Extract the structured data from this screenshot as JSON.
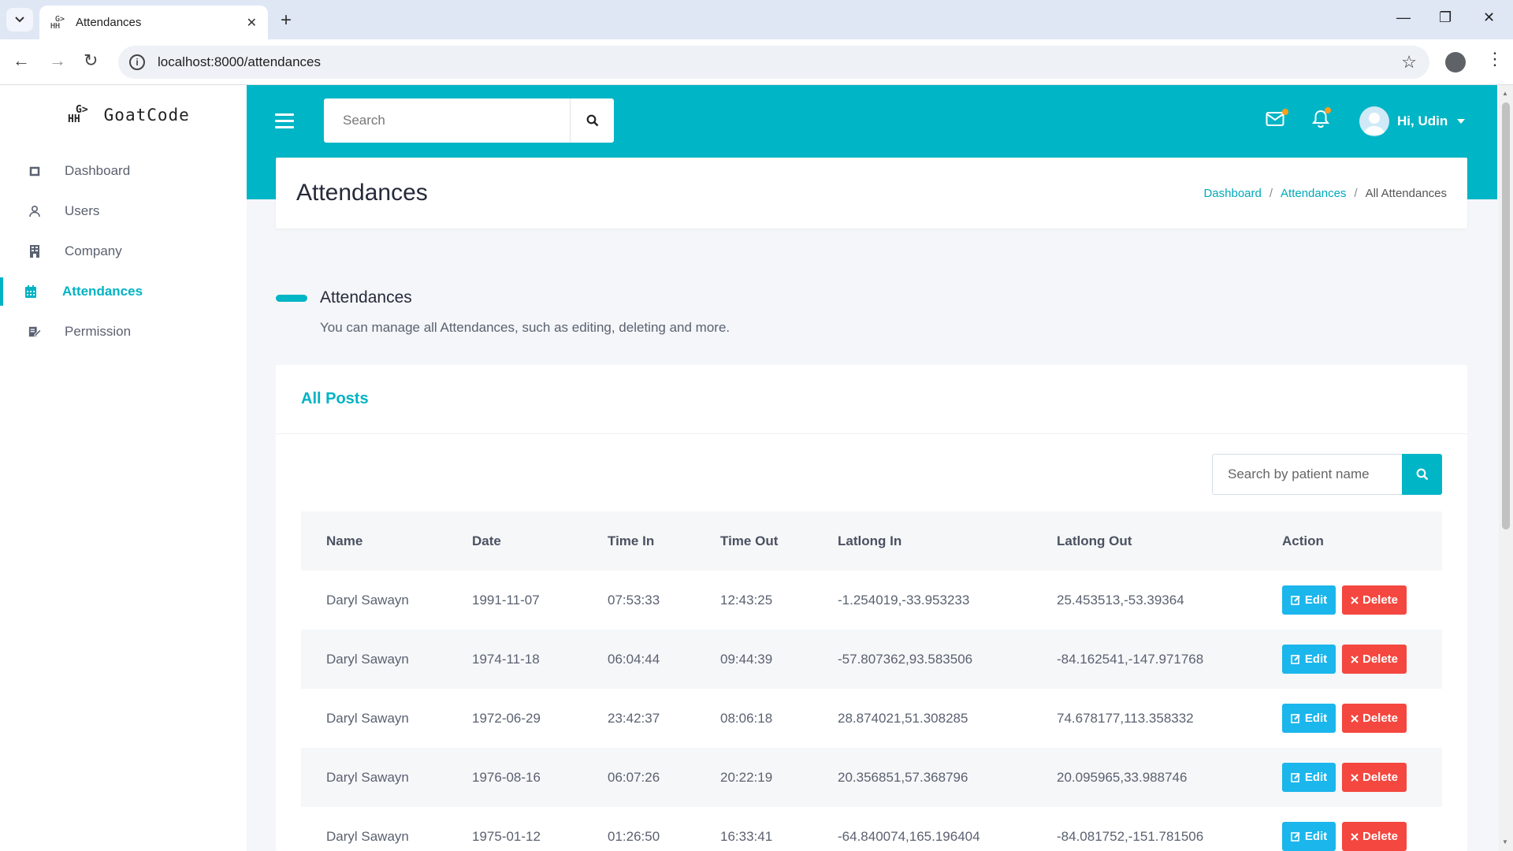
{
  "browser": {
    "tab_title": "Attendances",
    "url": "localhost:8000/attendances"
  },
  "app": {
    "brand": "GoatCode",
    "brand_logo_top": "G>",
    "brand_logo_bottom": "HH",
    "accent_color": "#00b5c5"
  },
  "sidebar": {
    "items": [
      {
        "label": "Dashboard",
        "icon": "dashboard-icon"
      },
      {
        "label": "Users",
        "icon": "user-icon"
      },
      {
        "label": "Company",
        "icon": "building-icon"
      },
      {
        "label": "Attendances",
        "icon": "calendar-icon",
        "active": true
      },
      {
        "label": "Permission",
        "icon": "edit-icon"
      }
    ]
  },
  "header": {
    "search_placeholder": "Search",
    "user_greeting": "Hi, Udin"
  },
  "page": {
    "title": "Attendances",
    "breadcrumb": [
      "Dashboard",
      "Attendances",
      "All Attendances"
    ],
    "section_title": "Attendances",
    "section_desc": "You can manage all Attendances, such as editing, deleting and more."
  },
  "card": {
    "title": "All Posts",
    "filter_placeholder": "Search by patient name"
  },
  "table": {
    "headers": [
      "Name",
      "Date",
      "Time In",
      "Time Out",
      "Latlong In",
      "Latlong Out",
      "Action"
    ],
    "rows": [
      [
        "Daryl Sawayn",
        "1991-11-07",
        "07:53:33",
        "12:43:25",
        "-1.254019,-33.953233",
        "25.453513,-53.39364"
      ],
      [
        "Daryl Sawayn",
        "1974-11-18",
        "06:04:44",
        "09:44:39",
        "-57.807362,93.583506",
        "-84.162541,-147.971768"
      ],
      [
        "Daryl Sawayn",
        "1972-06-29",
        "23:42:37",
        "08:06:18",
        "28.874021,51.308285",
        "74.678177,113.358332"
      ],
      [
        "Daryl Sawayn",
        "1976-08-16",
        "06:07:26",
        "20:22:19",
        "20.356851,57.368796",
        "20.095965,33.988746"
      ],
      [
        "Daryl Sawayn",
        "1975-01-12",
        "01:26:50",
        "16:33:41",
        "-64.840074,165.196404",
        "-84.081752,-151.781506"
      ]
    ],
    "edit_label": "Edit",
    "delete_label": "Delete"
  }
}
